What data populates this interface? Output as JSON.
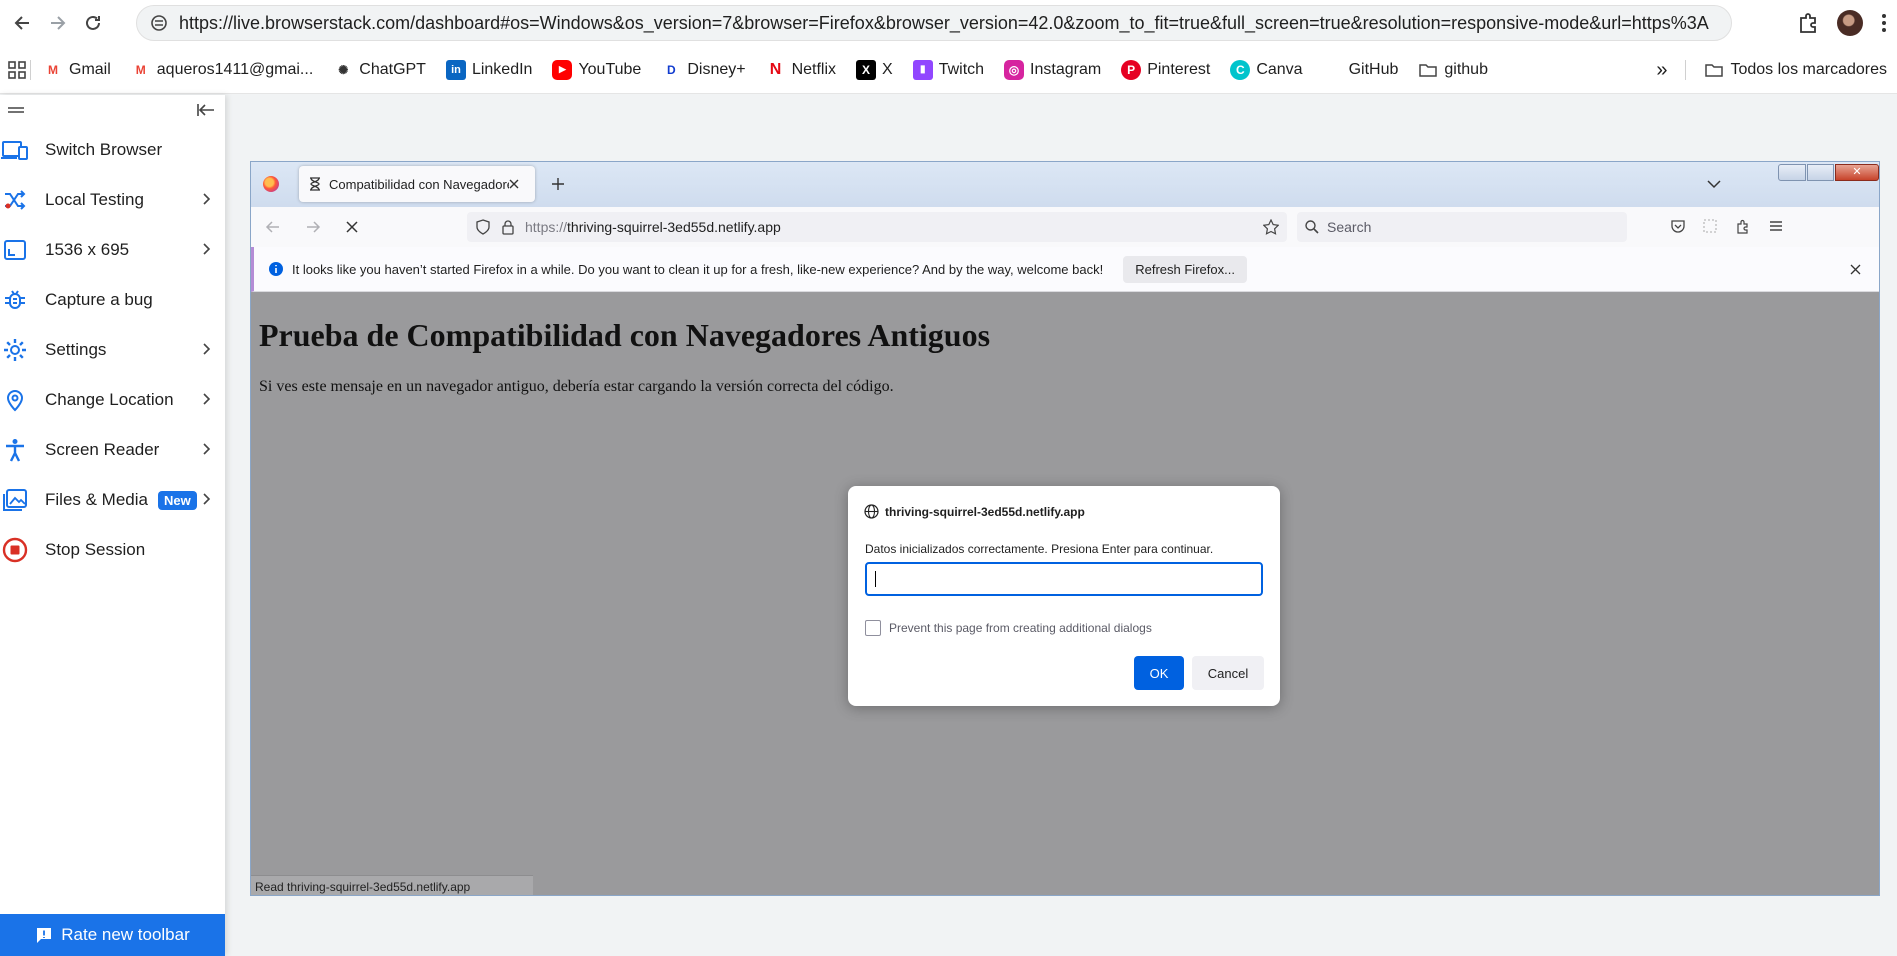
{
  "chrome": {
    "url": "https://live.browserstack.com/dashboard#os=Windows&os_version=7&browser=Firefox&browser_version=42.0&zoom_to_fit=true&full_screen=true&resolution=responsive-mode&url=https%3A..."
  },
  "bookmarks": {
    "items": [
      {
        "label": "Gmail",
        "icon": "gmail-icon"
      },
      {
        "label": "aqueros1411@gmai...",
        "icon": "gmail-icon"
      },
      {
        "label": "ChatGPT",
        "icon": "chatgpt-icon"
      },
      {
        "label": "LinkedIn",
        "icon": "linkedin-icon"
      },
      {
        "label": "YouTube",
        "icon": "youtube-icon"
      },
      {
        "label": "Disney+",
        "icon": "disney-icon"
      },
      {
        "label": "Netflix",
        "icon": "netflix-icon"
      },
      {
        "label": "X",
        "icon": "x-icon"
      },
      {
        "label": "Twitch",
        "icon": "twitch-icon"
      },
      {
        "label": "Instagram",
        "icon": "instagram-icon"
      },
      {
        "label": "Pinterest",
        "icon": "pinterest-icon"
      },
      {
        "label": "Canva",
        "icon": "canva-icon"
      },
      {
        "label": "GitHub",
        "icon": "github-icon"
      },
      {
        "label": "github",
        "icon": "folder-icon"
      }
    ],
    "more": "»",
    "all_bookmarks": "Todos los marcadores"
  },
  "sidebar": {
    "items": [
      {
        "label": "Switch Browser",
        "icon": "devices-icon",
        "has_chevron": false
      },
      {
        "label": "Local Testing",
        "icon": "shuffle-icon",
        "has_chevron": true
      },
      {
        "label": "1536 x 695",
        "icon": "resolution-icon",
        "has_chevron": true
      },
      {
        "label": "Capture a bug",
        "icon": "bug-icon",
        "has_chevron": false
      },
      {
        "label": "Settings",
        "icon": "gear-icon",
        "has_chevron": true
      },
      {
        "label": "Change Location",
        "icon": "location-pin-icon",
        "has_chevron": true
      },
      {
        "label": "Screen Reader",
        "icon": "accessibility-icon",
        "has_chevron": true
      },
      {
        "label": "Files & Media",
        "icon": "image-icon",
        "has_chevron": true,
        "badge": "New"
      },
      {
        "label": "Stop Session",
        "icon": "stop-icon",
        "has_chevron": false
      }
    ],
    "rate_button": "Rate new toolbar",
    "accent": "#1a73e8",
    "stop_color": "#d93025"
  },
  "firefox": {
    "tab_title": "Compatibilidad con Navegadores",
    "url": "https://thriving-squirrel-3ed55d.netlify.app",
    "url_scheme": "https://",
    "url_host": "thriving-squirrel-3ed55d.netlify.app",
    "search_placeholder": "Search",
    "notice_text": "It looks like you haven’t started Firefox in a while. Do you want to clean it up for a fresh, like-new experience? And by the way, welcome back!",
    "notice_button": "Refresh Firefox...",
    "status": "Read thriving-squirrel-3ed55d.netlify.app"
  },
  "page": {
    "heading": "Prueba de Compatibilidad con Navegadores Antiguos",
    "paragraph": "Si ves este mensaje en un navegador antiguo, debería estar cargando la versión correcta del código."
  },
  "dialog": {
    "title": "thriving-squirrel-3ed55d.netlify.app",
    "message": "Datos inicializados correctamente. Presiona Enter para continuar.",
    "input_value": "",
    "checkbox_label": "Prevent this page from creating additional dialogs",
    "ok": "OK",
    "cancel": "Cancel"
  }
}
